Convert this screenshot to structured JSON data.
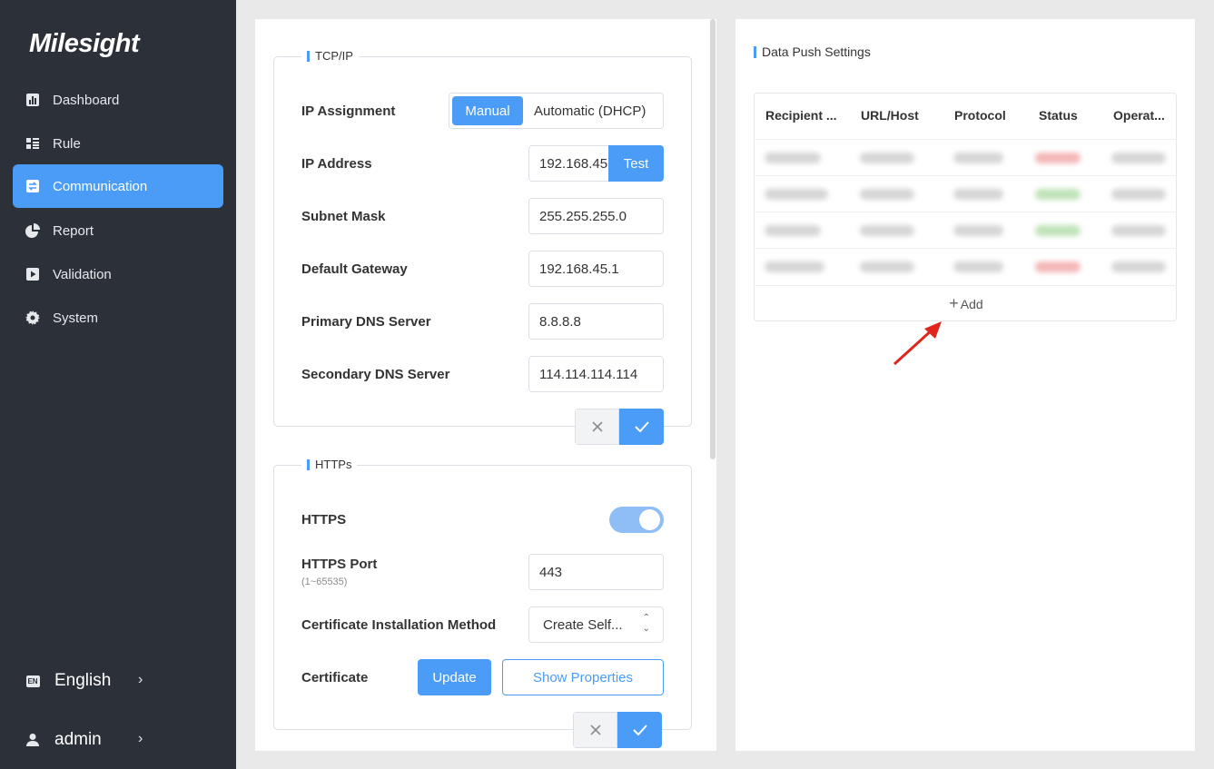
{
  "brand": {
    "logo_text": "Milesight"
  },
  "sidebar": {
    "items": [
      {
        "label": "Dashboard",
        "icon": "bar-chart-icon"
      },
      {
        "label": "Rule",
        "icon": "rule-list-icon"
      },
      {
        "label": "Communication",
        "icon": "communication-icon",
        "active": true
      },
      {
        "label": "Report",
        "icon": "pie-chart-icon"
      },
      {
        "label": "Validation",
        "icon": "play-box-icon"
      },
      {
        "label": "System",
        "icon": "gear-icon"
      }
    ],
    "language": {
      "badge": "EN",
      "label": "English"
    },
    "user": {
      "label": "admin"
    }
  },
  "tcpip": {
    "legend": "TCP/IP",
    "ip_assignment": {
      "label": "IP Assignment",
      "options": [
        "Manual",
        "Automatic (DHCP)"
      ],
      "selected": "Manual"
    },
    "ip_address": {
      "label": "IP Address",
      "value": "192.168.45.",
      "test_label": "Test"
    },
    "subnet_mask": {
      "label": "Subnet Mask",
      "value": "255.255.255.0"
    },
    "default_gateway": {
      "label": "Default Gateway",
      "value": "192.168.45.1"
    },
    "primary_dns": {
      "label": "Primary DNS Server",
      "value": "8.8.8.8"
    },
    "secondary_dns": {
      "label": "Secondary DNS Server",
      "value": "114.114.114.114"
    }
  },
  "https": {
    "legend": "HTTPs",
    "enable": {
      "label": "HTTPS",
      "on": true
    },
    "port": {
      "label": "HTTPS Port",
      "hint": "(1~65535)",
      "value": "443"
    },
    "cert_method": {
      "label": "Certificate Installation Method",
      "value": "Create Self..."
    },
    "certificate": {
      "label": "Certificate",
      "update_label": "Update",
      "show_label": "Show Properties"
    }
  },
  "data_push": {
    "title": "Data Push Settings",
    "columns": [
      "Recipient ...",
      "URL/Host",
      "Protocol",
      "Status",
      "Operat..."
    ],
    "row_status_colors": [
      "#f3b7b7",
      "#bfe3b8",
      "#bfe3b8",
      "#f3b7b7"
    ],
    "add_label": "Add"
  },
  "colors": {
    "accent": "#4a9cf6",
    "sidebar_bg": "#2c3039",
    "annotation_arrow": "#e0241e"
  }
}
